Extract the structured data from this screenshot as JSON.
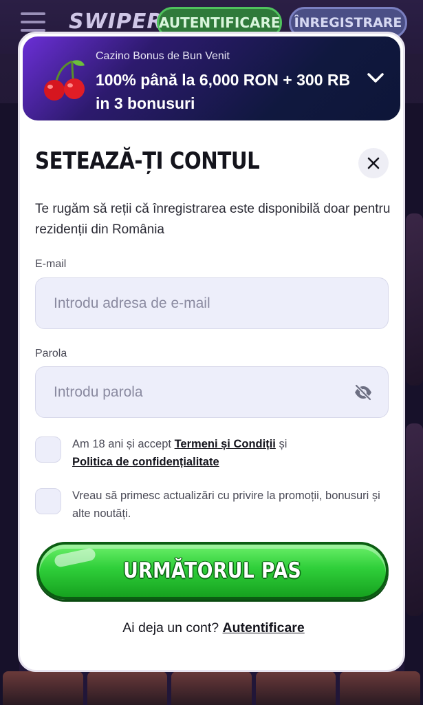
{
  "background": {
    "logo": "SWIPER",
    "header_login_label": "AUTENTIFICARE",
    "header_register_label": "ÎNREGISTRARE"
  },
  "bonus": {
    "subtitle": "Cazino Bonus de Bun Venit",
    "title": "100% până la 6,000 RON + 300 RB in 3 bonusuri",
    "icon": "cherry-icon",
    "toggle_icon": "chevron-down-icon"
  },
  "modal": {
    "title": "SETEAZĂ-ȚI CONTUL",
    "close_icon": "close-icon",
    "notice": "Te rugăm să reții că înregistrarea este disponibilă doar pentru rezidenții din România"
  },
  "form": {
    "email": {
      "label": "E-mail",
      "value": "",
      "placeholder": "Introdu adresa de e-mail"
    },
    "password": {
      "label": "Parola",
      "value": "",
      "placeholder": "Introdu parola",
      "toggle_icon": "eye-slash-icon"
    },
    "terms": {
      "checked": false,
      "text_before": "Am 18 ani și accept ",
      "terms_link": "Termeni și Condiții",
      "text_middle": " și",
      "privacy_link": "Politica de confidențialitate"
    },
    "promo": {
      "checked": false,
      "text": "Vreau să primesc actualizări cu privire la promoții, bonusuri și alte noutăți."
    },
    "next_button": "URMĂTORUL PAS",
    "login_prompt": "Ai deja un cont?",
    "login_link": "Autentificare"
  },
  "colors": {
    "primary_green": "#2fcf3a",
    "banner_dark": "#10183f",
    "field_bg": "#edeefa",
    "text_dark": "#14141c"
  }
}
